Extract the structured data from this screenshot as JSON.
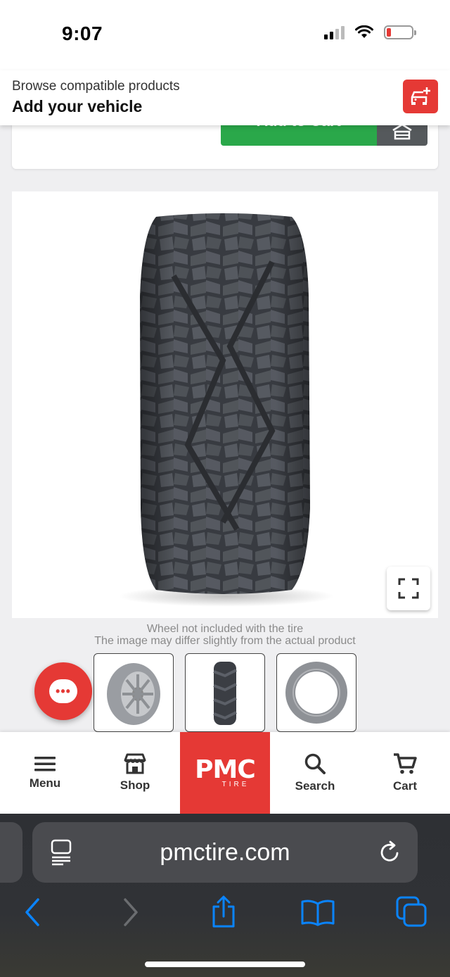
{
  "status_bar": {
    "time": "9:07"
  },
  "vehicle_banner": {
    "subtitle": "Browse compatible products",
    "title": "Add your vehicle",
    "icon": "add-vehicle-icon"
  },
  "cart": {
    "add_to_cart_label": "Add to Cart",
    "garage_icon": "garage-icon"
  },
  "product_image": {
    "alt": "Tire tread front view",
    "expand_icon": "fullscreen-expand-icon"
  },
  "disclaimer": {
    "line1": "Wheel not included with the tire",
    "line2": "The image may differ slightly from the actual product"
  },
  "thumbnails": [
    {
      "name": "tire-with-wheel"
    },
    {
      "name": "tire-tread-front"
    },
    {
      "name": "tire-side"
    }
  ],
  "bottom_nav": {
    "items": [
      {
        "label": "Menu",
        "icon": "hamburger-icon"
      },
      {
        "label": "Shop",
        "icon": "storefront-icon"
      },
      {
        "label": "Search",
        "icon": "search-icon"
      },
      {
        "label": "Cart",
        "icon": "cart-icon"
      }
    ],
    "logo_text": "PMC",
    "logo_sub": "TIRE"
  },
  "browser": {
    "url": "pmctire.com"
  },
  "colors": {
    "brand_red": "#e53935",
    "cart_green": "#2aa84a",
    "ios_blue": "#0a84ff"
  }
}
